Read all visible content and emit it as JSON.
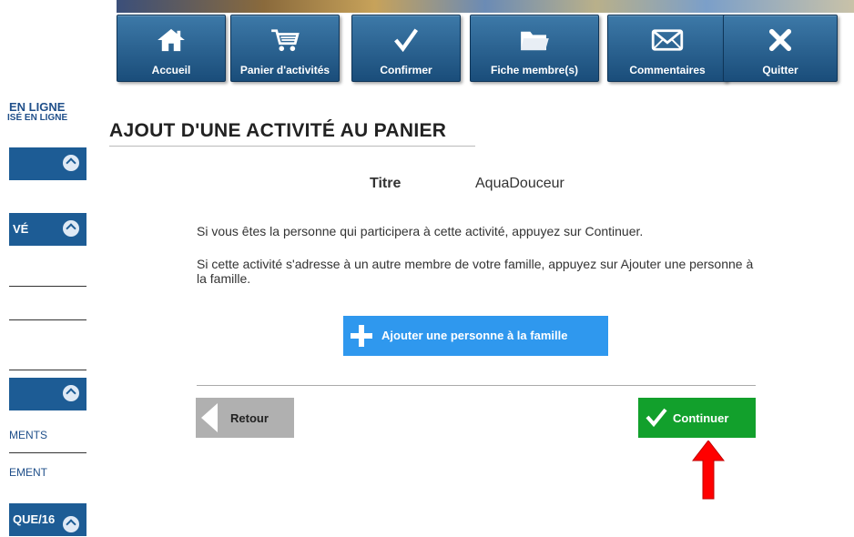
{
  "nav": [
    {
      "label": "Accueil",
      "icon": "home-icon"
    },
    {
      "label": "Panier d'activités",
      "icon": "cart-icon"
    },
    {
      "label": "Confirmer",
      "icon": "checkmark-icon"
    },
    {
      "label": "Fiche membre(s)",
      "icon": "folder-icon"
    },
    {
      "label": "Commentaires",
      "icon": "envelope-icon"
    },
    {
      "label": "Quitter",
      "icon": "close-icon"
    }
  ],
  "sidebar": {
    "title": "EN LIGNE",
    "subtitle": "ISÉ EN LIGNE",
    "section2": "VÉ",
    "link1": "MENTS",
    "link2": "EMENT",
    "section4": "QUE/16"
  },
  "main": {
    "page_title": "AJOUT D'UNE ACTIVITÉ AU PANIER",
    "titre_label": "Titre",
    "titre_value": "AquaDouceur",
    "instruction_1": "Si vous êtes la personne qui participera à cette activité, appuyez sur Continuer.",
    "instruction_2": "Si cette activité s'adresse à un autre membre de votre famille, appuyez sur Ajouter une personne à la famille.",
    "add_button": "Ajouter une personne à la famille",
    "back_button": "Retour",
    "continue_button": "Continuer"
  },
  "colors": {
    "nav_blue": "#1a4d7a",
    "add_blue": "#2f98ee",
    "continue_green": "#12a02c",
    "back_gray": "#b0b0b0",
    "arrow_red": "#ff0000"
  }
}
